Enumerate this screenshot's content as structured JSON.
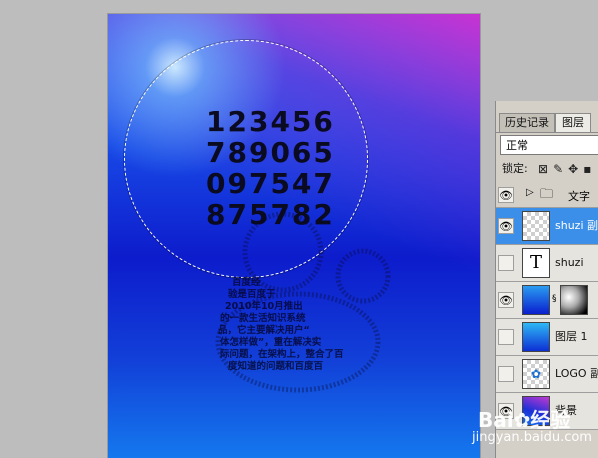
{
  "canvas": {
    "numbers": [
      "123456",
      "789065",
      "097547",
      "875782"
    ],
    "bear_text_lines": [
      "百度经",
      "验是百度于",
      "2010年10月推出",
      "的一款生活知识系统",
      "品，它主要解决用户“",
      "体怎样做”，重在解决实",
      "际问题，在架构上，整合了百",
      "度知道的问题和百度百"
    ]
  },
  "layers_panel": {
    "tabs": [
      "历史记录",
      "图层"
    ],
    "active_tab": "图层",
    "blend_mode": "正常",
    "lock_label": "锁定:",
    "layers": [
      {
        "name": "文字",
        "type": "group",
        "visible": true
      },
      {
        "name": "shuzi 副",
        "type": "transparent",
        "visible": true,
        "selected": true
      },
      {
        "name": "shuzi",
        "type": "text",
        "visible": false
      },
      {
        "name": "",
        "type": "gradient-mask",
        "visible": true
      },
      {
        "name": "图层 1",
        "type": "gradient",
        "visible": false
      },
      {
        "name": "LOGO 副",
        "type": "logo",
        "visible": false
      },
      {
        "name": "背景",
        "type": "background",
        "visible": true
      }
    ]
  },
  "watermark": {
    "brand": "Bai",
    "brand_suffix": "经验",
    "url": "jingyan.baidu.com"
  },
  "colors": {
    "selected_layer": "#3b8fe8",
    "panel_bg": "#d4d0c8"
  }
}
